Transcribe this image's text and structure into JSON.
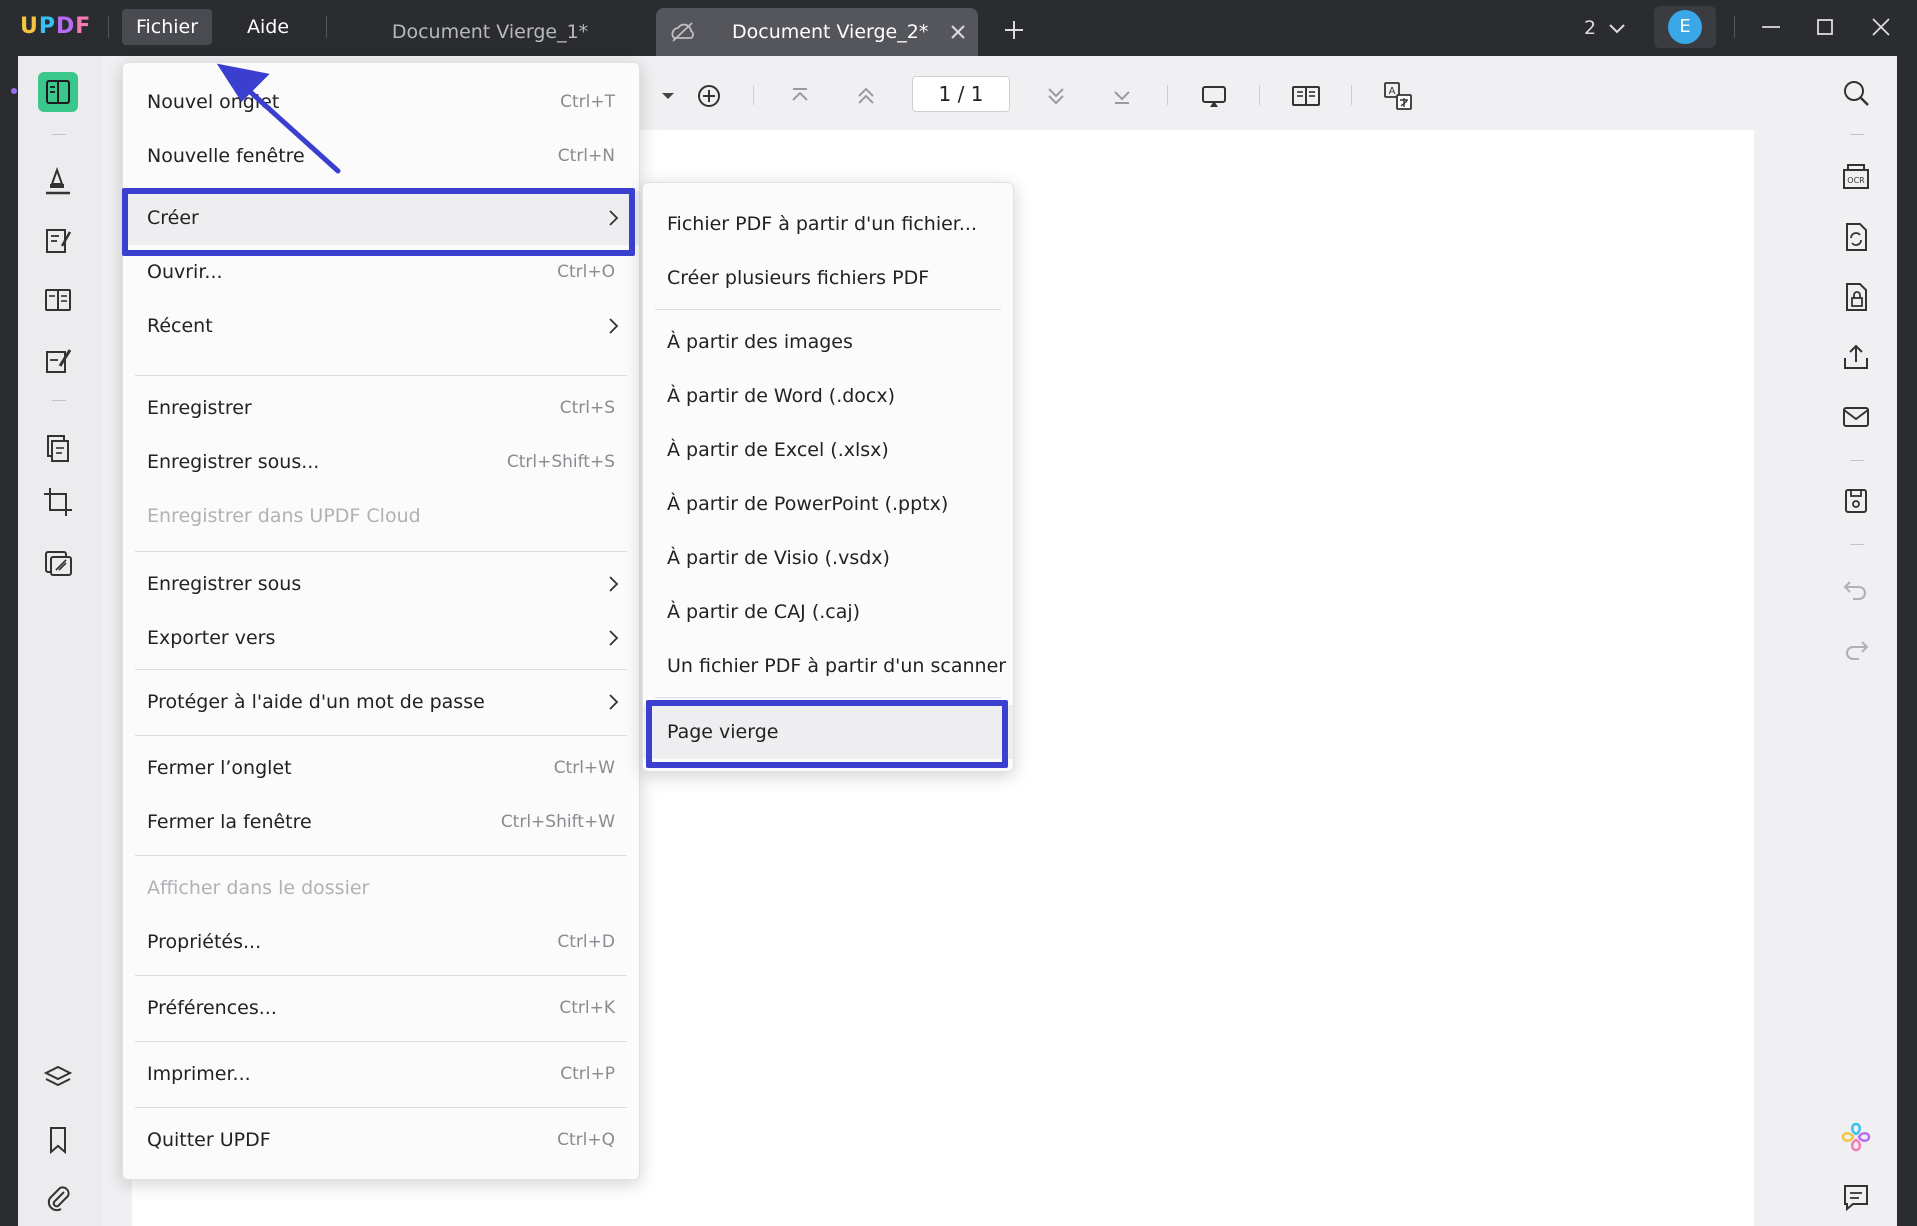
{
  "app": {
    "logo": [
      "U",
      "P",
      "D",
      "F"
    ],
    "menubar": {
      "file": "Fichier",
      "help": "Aide"
    },
    "tabs": [
      {
        "label": "Document Vierge_1*",
        "active": false
      },
      {
        "label": "Document Vierge_2*",
        "active": true
      }
    ],
    "tab_count": "2",
    "avatar_initial": "E"
  },
  "toolbar": {
    "page_indicator": "1 / 1"
  },
  "file_menu": {
    "new_tab": {
      "label": "Nouvel onglet",
      "shortcut": "Ctrl+T"
    },
    "new_window": {
      "label": "Nouvelle fenêtre",
      "shortcut": "Ctrl+N"
    },
    "create": {
      "label": "Créer"
    },
    "open": {
      "label": "Ouvrir...",
      "shortcut": "Ctrl+O"
    },
    "recent": {
      "label": "Récent"
    },
    "save": {
      "label": "Enregistrer",
      "shortcut": "Ctrl+S"
    },
    "save_as": {
      "label": "Enregistrer sous...",
      "shortcut": "Ctrl+Shift+S"
    },
    "save_cloud": {
      "label": "Enregistrer dans UPDF Cloud"
    },
    "save_as_sub": {
      "label": "Enregistrer sous"
    },
    "export": {
      "label": "Exporter vers"
    },
    "protect": {
      "label": "Protéger à l'aide d'un mot de passe"
    },
    "close_tab": {
      "label": "Fermer l’onglet",
      "shortcut": "Ctrl+W"
    },
    "close_window": {
      "label": "Fermer la fenêtre",
      "shortcut": "Ctrl+Shift+W"
    },
    "show_folder": {
      "label": "Afficher dans le dossier"
    },
    "properties": {
      "label": "Propriétés...",
      "shortcut": "Ctrl+D"
    },
    "preferences": {
      "label": "Préférences...",
      "shortcut": "Ctrl+K"
    },
    "print": {
      "label": "Imprimer...",
      "shortcut": "Ctrl+P"
    },
    "quit": {
      "label": "Quitter UPDF",
      "shortcut": "Ctrl+Q"
    }
  },
  "create_submenu": {
    "items": [
      "Fichier PDF à partir d'un fichier...",
      "Créer plusieurs fichiers PDF",
      "À partir des images",
      "À partir de Word (.docx)",
      "À partir de Excel (.xlsx)",
      "À partir de PowerPoint (.pptx)",
      "À partir de Visio (.vsdx)",
      "À partir de CAJ (.caj)",
      "Un fichier PDF à partir d'un scanner",
      "Page vierge"
    ]
  },
  "colors": {
    "titlebar": "#2b2c30",
    "highlight": "#3a3fd0",
    "active_tool": "#3bc78c",
    "avatar": "#3aa7e6"
  },
  "icons": {
    "left_sidebar": [
      "reader-icon",
      "highlighter-icon",
      "edit-text-icon",
      "organize-pages-icon",
      "fill-sign-icon",
      "page-tools-icon",
      "crop-icon",
      "compress-icon",
      "layers-icon",
      "bookmark-icon",
      "attachment-icon"
    ],
    "right_sidebar": [
      "search-icon",
      "ocr-icon",
      "convert-icon",
      "protect-icon",
      "share-icon",
      "email-icon",
      "save-icon",
      "undo-icon",
      "redo-icon",
      "ai-assistant-icon",
      "comment-icon"
    ]
  }
}
